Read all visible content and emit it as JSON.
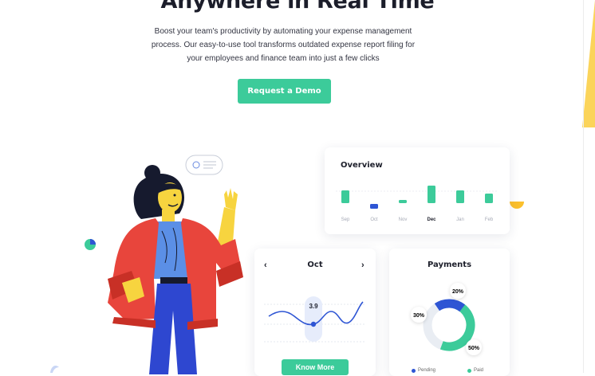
{
  "hero": {
    "title": "Anywhere in Real Time",
    "subtitle_lines": [
      "Boost your team's productivity by automating your expense management",
      "process. Our easy-to-use tool transforms outdated expense report filing for",
      "your employees and finance team into just a few clicks"
    ],
    "cta_label": "Request a Demo"
  },
  "overview": {
    "title": "Overview",
    "months": [
      "Sep",
      "Oct",
      "Nov",
      "Dec",
      "Jan",
      "Feb"
    ],
    "active_month": "Dec"
  },
  "calendar": {
    "month": "Oct",
    "prev_icon": "‹",
    "next_icon": "›",
    "value": "3.9",
    "button_label": "Know More"
  },
  "payments": {
    "title": "Payments",
    "labels": [
      "20%",
      "30%",
      "50%"
    ],
    "legend": [
      "Pending",
      "Paid"
    ]
  },
  "colors": {
    "accent": "#3ccb9a",
    "blue": "#2e55d4",
    "yellow": "#fbd45a",
    "red": "#e8453c"
  },
  "icons": [
    "chevron-left-icon",
    "chevron-right-icon",
    "speech-bubble-icon",
    "pie-chart-icon"
  ]
}
